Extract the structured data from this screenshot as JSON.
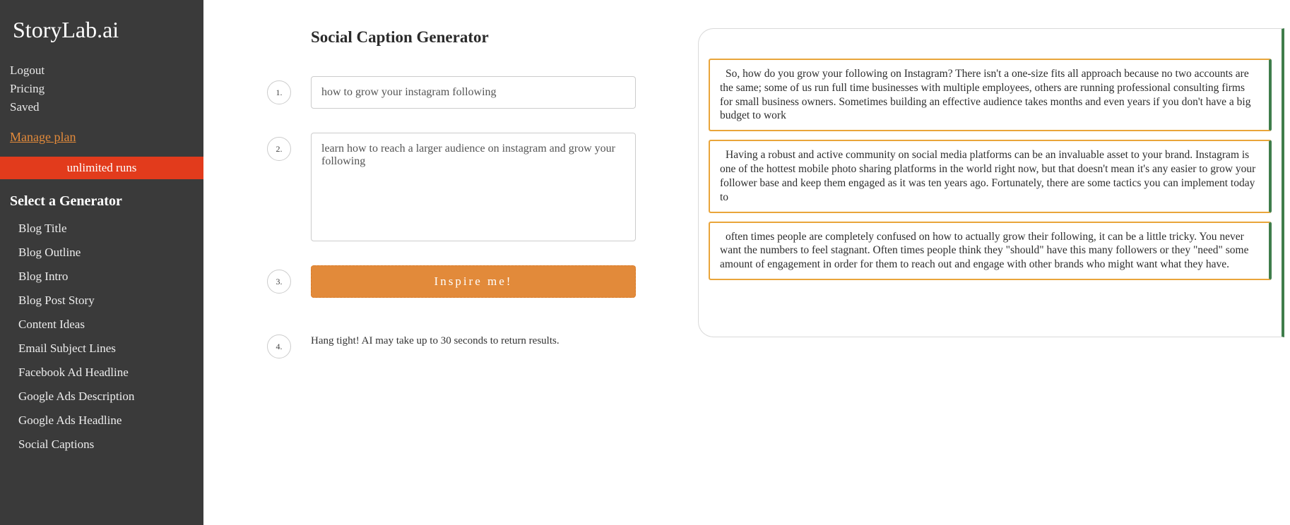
{
  "sidebar": {
    "logo": "StoryLab.ai",
    "nav": {
      "logout": "Logout",
      "pricing": "Pricing",
      "saved": "Saved",
      "manage_plan": "Manage plan"
    },
    "banner": "unlimited runs",
    "generators_heading": "Select a Generator",
    "generators": [
      "Blog Title",
      "Blog Outline",
      "Blog Intro",
      "Blog Post Story",
      "Content Ideas",
      "Email Subject Lines",
      "Facebook Ad Headline",
      "Google Ads Description",
      "Google Ads Headline",
      "Social Captions"
    ]
  },
  "form": {
    "title": "Social Caption Generator",
    "steps": {
      "1": "1.",
      "2": "2.",
      "3": "3.",
      "4": "4."
    },
    "input1_value": "how to grow your instagram following",
    "input2_value": "learn how to reach a larger audience on instagram and grow your following",
    "button_label": "Inspire me!",
    "hint": "Hang tight! AI may take up to 30 seconds to return results."
  },
  "results": [
    "So, how do you grow your following on Instagram? There isn't a one-size fits all approach because no two accounts are the same; some of us run full time businesses with multiple employees, others are running professional consulting firms for small business owners. Sometimes building an effective audience takes months and even years if you don't have a big budget to work",
    "Having a robust and active community on social media platforms can be an invaluable asset to your brand. Instagram is one of the hottest mobile photo sharing platforms in the world right now, but that doesn't mean it's any easier to grow your follower base and keep them engaged as it was ten years ago. Fortunately, there are some tactics you can implement today to",
    "often times people are completely confused on how to actually grow their following, it can be a little tricky. You never want the numbers to feel stagnant. Often times people think they \"should\" have this many followers or they \"need\" some amount of engagement in order for them to reach out and engage with other brands who might want what they have."
  ]
}
